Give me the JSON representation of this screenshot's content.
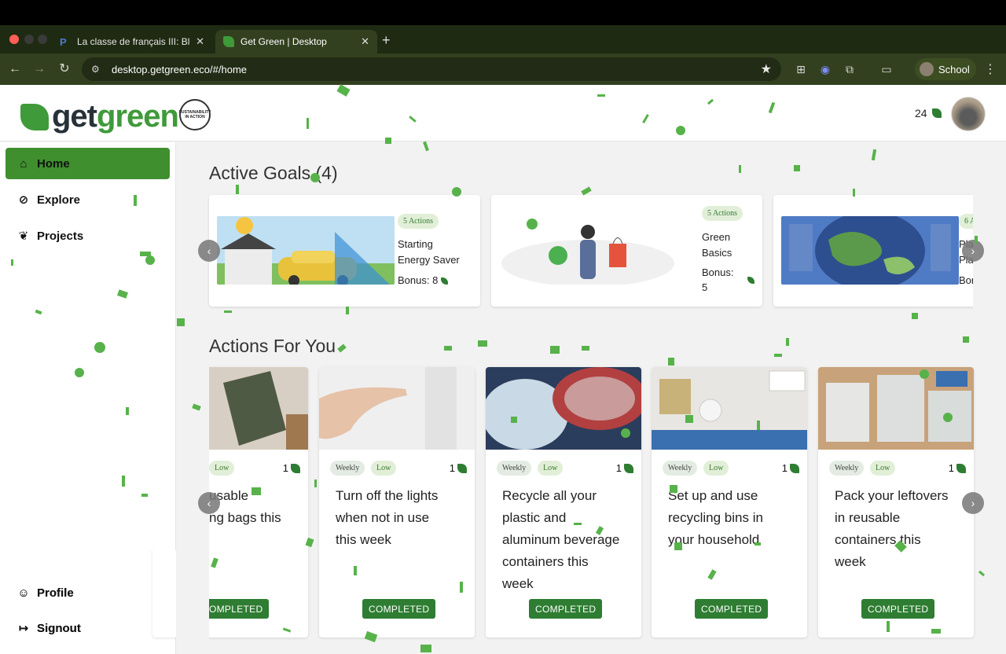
{
  "browser": {
    "tabs": [
      {
        "title": "La classe de français III: Block",
        "active": false
      },
      {
        "title": "Get Green | Desktop",
        "active": true
      }
    ],
    "url": "desktop.getgreen.eco/#/home",
    "profile_label": "School"
  },
  "header": {
    "logo_part1": "get",
    "logo_part2": "green",
    "seal_text": "SUSTAINABILITY IN ACTION",
    "points": "24"
  },
  "sidebar": {
    "items": [
      {
        "label": "Home",
        "icon": "home-icon",
        "active": true
      },
      {
        "label": "Explore",
        "icon": "compass-icon"
      },
      {
        "label": "Projects",
        "icon": "leaf-icon"
      }
    ],
    "bottom": [
      {
        "label": "Profile",
        "icon": "face-icon"
      },
      {
        "label": "Signout",
        "icon": "signout-icon"
      }
    ]
  },
  "active_goals": {
    "title": "Active Goals (4)",
    "cards": [
      {
        "actions": "5 Actions",
        "name_line1": "Starting",
        "name_line2": "Energy Saver",
        "bonus": "Bonus: 8"
      },
      {
        "actions": "5 Actions",
        "name_line1": "Green",
        "name_line2": "Basics",
        "bonus_line1": "Bonus:",
        "bonus_line2": "5"
      },
      {
        "actions": "6 A",
        "name_line1": "Pla",
        "name_line2": "Pla",
        "bonus": "Bon"
      }
    ]
  },
  "actions_for_you": {
    "title": "Actions For You",
    "cards": [
      {
        "frequency": "",
        "level": "Low",
        "points": "1",
        "text_lines": [
          "usable",
          "ng bags this"
        ],
        "button": "OMPLETED"
      },
      {
        "frequency": "Weekly",
        "level": "Low",
        "points": "1",
        "text_lines": [
          "Turn off the lights",
          "when not in use",
          "this week"
        ],
        "button": "COMPLETED"
      },
      {
        "frequency": "Weekly",
        "level": "Low",
        "points": "1",
        "text_lines": [
          "Recycle all your",
          "plastic and",
          "aluminum beverage",
          "containers this",
          "week"
        ],
        "button": "COMPLETED"
      },
      {
        "frequency": "Weekly",
        "level": "Low",
        "points": "1",
        "text_lines": [
          "Set up and use",
          "recycling bins in",
          "your household"
        ],
        "button": "COMPLETED"
      },
      {
        "frequency": "Weekly",
        "level": "Low",
        "points": "1",
        "text_lines": [
          "Pack your leftovers",
          "in reusable",
          "containers this",
          "week"
        ],
        "button": "COMPLETED"
      }
    ]
  },
  "colors": {
    "brand_green": "#3f9a3a",
    "button_green": "#2e7d32",
    "chrome_dark": "#33401f"
  }
}
